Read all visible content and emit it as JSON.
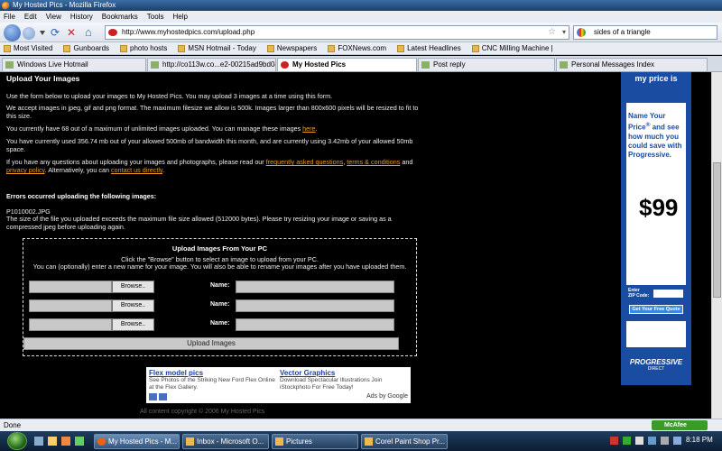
{
  "window": {
    "title": "My Hosted Pics - Mozilla Firefox"
  },
  "menu": [
    "File",
    "Edit",
    "View",
    "History",
    "Bookmarks",
    "Tools",
    "Help"
  ],
  "address": {
    "url": "http://www.myhostedpics.com/upload.php",
    "search": "sides of a triangle"
  },
  "bookmarks": [
    "Most Visited",
    "Gunboards",
    "photo hosts",
    "MSN Hotmail - Today",
    "Newspapers",
    "FOXNews.com",
    "Latest Headlines",
    "CNC Milling Machine |"
  ],
  "tabs": [
    {
      "label": "Windows Live Hotmail",
      "active": false
    },
    {
      "label": "http://co113w.co...e2-00215ad9bd04",
      "active": false
    },
    {
      "label": "My Hosted Pics",
      "active": true
    },
    {
      "label": "Post reply",
      "active": false
    },
    {
      "label": "Personal Messages Index",
      "active": false
    }
  ],
  "page": {
    "heading": "Upload Your Images",
    "intro": "Use the form below to upload your images to My Hosted Pics. You may upload 3 images at a time using this form.",
    "formats": "We accept images in jpeg, gif and png format. The maximum filesize we allow is 500k. Images larger than 800x600 pixels will be resized to fit to this size.",
    "count_text": "You currently have 68 out of a maximum of unlimited images uploaded. You can manage these images",
    "count_link": "here",
    "bandwidth": "You have currently used 356.74 mb out of your allowed 500mb of bandwidth this month, and are currently using 3.42mb of your allowed 50mb space.",
    "questions_pre": "If you have any questions about uploading your images and photographs, please read our",
    "faq_link": "frequently asked questions",
    "terms_link": "terms & conditions",
    "and_text": "and",
    "privacy_link": "privacy policy",
    "alt_text": ". Alternatively, you can",
    "contact_link": "contact us directly",
    "errors_heading": "Errors occurred uploading the following images:",
    "error_file": "P1010002.JPG",
    "error_msg": "The size of the file you uploaded exceeds the maximum file size allowed (512000 bytes). Please try resizing your image or saving as a compressed jpeg before uploading again."
  },
  "upload": {
    "title": "Upload Images From Your PC",
    "line1": "Click the \"Browse\" button to select an image to upload from your PC.",
    "line2": "You can (optionally) enter a new name for your image. You will also be able to rename your images after you have uploaded them.",
    "browse_label": "Browse..",
    "name_label": "Name:",
    "submit_label": "Upload Images"
  },
  "ads": {
    "ad1_title": "Flex model pics",
    "ad1_text": "See Photos of the Striking New Ford Flex Online at the Flex Gallery.",
    "ad2_title": "Vector Graphics",
    "ad2_text": "Download Spectacular Illustrations Join iStockphoto For Free Today!",
    "adsby": "Ads by Google"
  },
  "side_ad": {
    "top": "my price is",
    "name": "Name Your Price",
    "reg": "®",
    "body": "and see how much you could save with Progressive.",
    "price": "$99",
    "enter": "Enter",
    "zip": "ZIP Code:",
    "quote": "Get Your Free Quote",
    "brand": "PROGRESSIVE",
    "brand_sub": "DIRECT"
  },
  "footer": {
    "copyright": "All content copyright © 2006 My Hosted Pics"
  },
  "status": {
    "text": "Done",
    "mcafee": "McAfee"
  },
  "taskbar": {
    "items": [
      "My Hosted Pics - M...",
      "Inbox - Microsoft O...",
      "Pictures",
      "Corel Paint Shop Pr..."
    ],
    "clock": "8:18 PM"
  },
  "colors": {
    "link": "#f29c1c",
    "progressive_blue": "#1a4da1"
  }
}
